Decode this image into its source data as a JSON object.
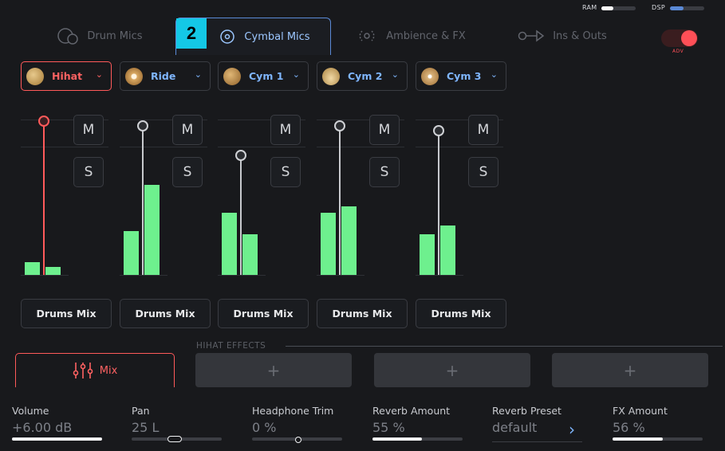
{
  "meters": {
    "ram_label": "RAM",
    "ram_level": 0.35,
    "dsp_label": "DSP",
    "dsp_level": 0.4,
    "ram_color": "#ffffff",
    "dsp_color": "#5b8ad6"
  },
  "tabs": [
    {
      "label": "Drum Mics",
      "icon": "drum-mic-icon",
      "active": false
    },
    {
      "label": "Cymbal Mics",
      "icon": "cymbal-icon",
      "active": true
    },
    {
      "label": "Ambience & FX",
      "icon": "ambience-icon",
      "active": false
    },
    {
      "label": "Ins & Outs",
      "icon": "ins-outs-icon",
      "active": false
    }
  ],
  "tab_badge": "2",
  "adv_toggle": {
    "label": "ADV",
    "on": true,
    "color": "#ff4f57"
  },
  "mics": [
    {
      "label": "Hihat",
      "active": true,
      "fader": 1.0,
      "bars": [
        0.04,
        0.025
      ],
      "output": "Drums Mix",
      "m_label": "M",
      "s_label": "S"
    },
    {
      "label": "Ride",
      "active": false,
      "fader": 0.97,
      "bars": [
        0.14,
        0.29
      ],
      "output": "Drums Mix",
      "m_label": "M",
      "s_label": "S"
    },
    {
      "label": "Cym 1",
      "active": false,
      "fader": 0.78,
      "bars": [
        0.2,
        0.13
      ],
      "output": "Drums Mix",
      "m_label": "M",
      "s_label": "S"
    },
    {
      "label": "Cym 2",
      "active": false,
      "fader": 0.97,
      "bars": [
        0.2,
        0.22
      ],
      "output": "Drums Mix",
      "m_label": "M",
      "s_label": "S"
    },
    {
      "label": "Cym 3",
      "active": false,
      "fader": 0.94,
      "bars": [
        0.13,
        0.16
      ],
      "output": "Drums Mix",
      "m_label": "M",
      "s_label": "S"
    }
  ],
  "effects": {
    "title": "HIHAT EFFECTS",
    "mix_label": "Mix",
    "slots": [
      "+",
      "+",
      "+"
    ]
  },
  "params": [
    {
      "label": "Volume",
      "value": "+6.00 dB",
      "level": 1.0,
      "style": "fill"
    },
    {
      "label": "Pan",
      "value": "25 L",
      "level": 0.4,
      "style": "knob"
    },
    {
      "label": "Headphone Trim",
      "value": "0 %",
      "level": 0.5,
      "style": "dot"
    },
    {
      "label": "Reverb Amount",
      "value": "55 %",
      "level": 0.55,
      "style": "fill"
    },
    {
      "label": "Reverb Preset",
      "value": "default",
      "level": null,
      "style": "select"
    },
    {
      "label": "FX Amount",
      "value": "56 %",
      "level": 0.56,
      "style": "fill"
    }
  ],
  "accent_active": "#ff5a5a",
  "accent_blue": "#7fb6ff",
  "meter_green": "#6ef08e"
}
